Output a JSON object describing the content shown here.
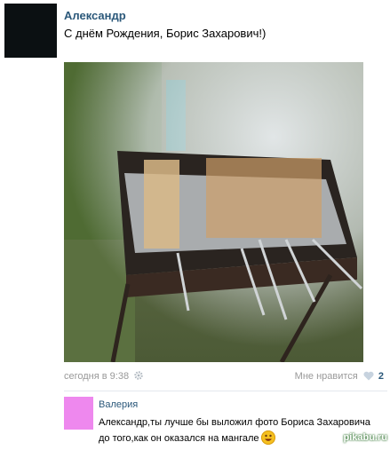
{
  "post": {
    "author": "Александр",
    "text": "С днём Рождения, Борис Захарович!)",
    "date": "сегодня в 9:38",
    "like_label": "Мне нравится",
    "like_count": "2"
  },
  "comment": {
    "author": "Валерия",
    "text": "Александр,ты лучше бы выложил фото Бориса Захаровича до того,как он оказался на мангале"
  },
  "watermark": "pikabu.ru",
  "colors": {
    "link": "#2b587a",
    "meta": "#999999",
    "comment_avatar": "#ee88ee"
  },
  "icons": {
    "date_settings": "gear-icon",
    "like": "heart-icon",
    "emoji": "smile-emoji-icon"
  }
}
